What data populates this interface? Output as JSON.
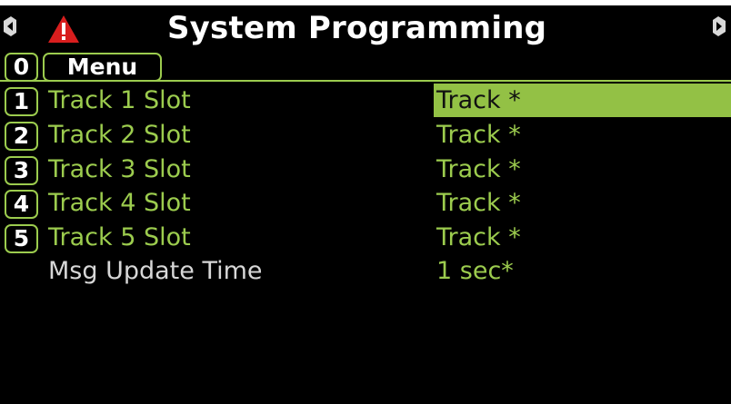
{
  "header": {
    "title": "System Programming",
    "colors": {
      "background": "#000000",
      "accent": "#9ccc4e",
      "warning": "#d81e1e"
    },
    "icons": [
      "left-arrow-icon",
      "warning-icon",
      "right-arrow-icon"
    ]
  },
  "menu": {
    "key": "0",
    "label": "Menu"
  },
  "rows": [
    {
      "key": "1",
      "label": "Track 1 Slot",
      "value": "Track *",
      "selected": true
    },
    {
      "key": "2",
      "label": "Track 2 Slot",
      "value": "Track *",
      "selected": false
    },
    {
      "key": "3",
      "label": "Track 3 Slot",
      "value": "Track *",
      "selected": false
    },
    {
      "key": "4",
      "label": "Track 4 Slot",
      "value": "Track *",
      "selected": false
    },
    {
      "key": "5",
      "label": "Track 5 Slot",
      "value": "Track *",
      "selected": false
    },
    {
      "key": "",
      "label": "Msg Update Time",
      "value": "1 sec*",
      "selected": false
    }
  ]
}
